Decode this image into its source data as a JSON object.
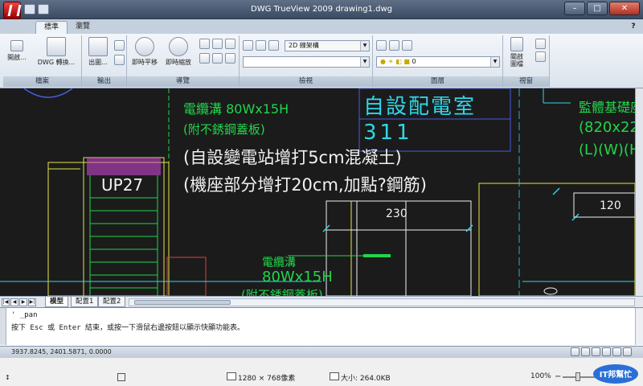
{
  "window": {
    "title": "DWG TrueView 2009 drawing1.dwg",
    "help_label": "?",
    "controls": {
      "minimize": "–",
      "maximize": "□",
      "close": "✕"
    }
  },
  "ribbon_tabs": [
    "標準",
    "瀏覽"
  ],
  "ribbon": {
    "panels": {
      "file": {
        "title": "檔案",
        "open_label": "開啟...",
        "dwg_convert_label": "DWG 轉換..."
      },
      "output": {
        "title": "輸出",
        "plot_label": "出圖..."
      },
      "navigate": {
        "title": "導覽",
        "pan_label": "即時平移",
        "zoom_label": "即時縮放"
      },
      "view": {
        "title": "檢視",
        "visual_style": "2D 線架構"
      },
      "layers": {
        "title": "圖層",
        "current_layer": "0"
      },
      "window_panel": {
        "title": "視窗",
        "switch_label": "關啟圖檔"
      }
    }
  },
  "drawing": {
    "texts": [
      "電纜溝  80Wx15H",
      "(附不銹鋼蓋板)",
      "自設配電室",
      "311",
      "(自設變電站增打5cm混凝土)",
      "(機座部分增打20cm,加點?鋼筋)",
      "UP27",
      "230",
      "120",
      "電纜溝",
      "80Wx15H",
      "(附不銹鋼蓋板)",
      "監體基礎座",
      "(820x22",
      "(L)(W)(H"
    ]
  },
  "layout_tabs": [
    "模型",
    "配置1",
    "配置2"
  ],
  "command": {
    "line1": "' _pan",
    "line2": "按下 Esc 或 Enter 結束，或按一下滑鼠右邊按鈕以顯示快顯功能表。"
  },
  "status": {
    "coords": "3937.8245, 2401.5871, 0.0000"
  },
  "viewer_bar": {
    "dimensions": "1280 × 768像素",
    "size": "大小: 264.0KB",
    "zoom": "100%"
  },
  "logo": {
    "text": "IT邦幫忙"
  },
  "colors": {
    "cad_background": "#1b1b1b",
    "cad_green": "#21d64a",
    "cad_cyan": "#2fd7e8",
    "cad_yellow": "#e6e64a",
    "cad_magenta": "#d24ad8",
    "cad_blue": "#4a5be0",
    "cad_red": "#d84040"
  }
}
